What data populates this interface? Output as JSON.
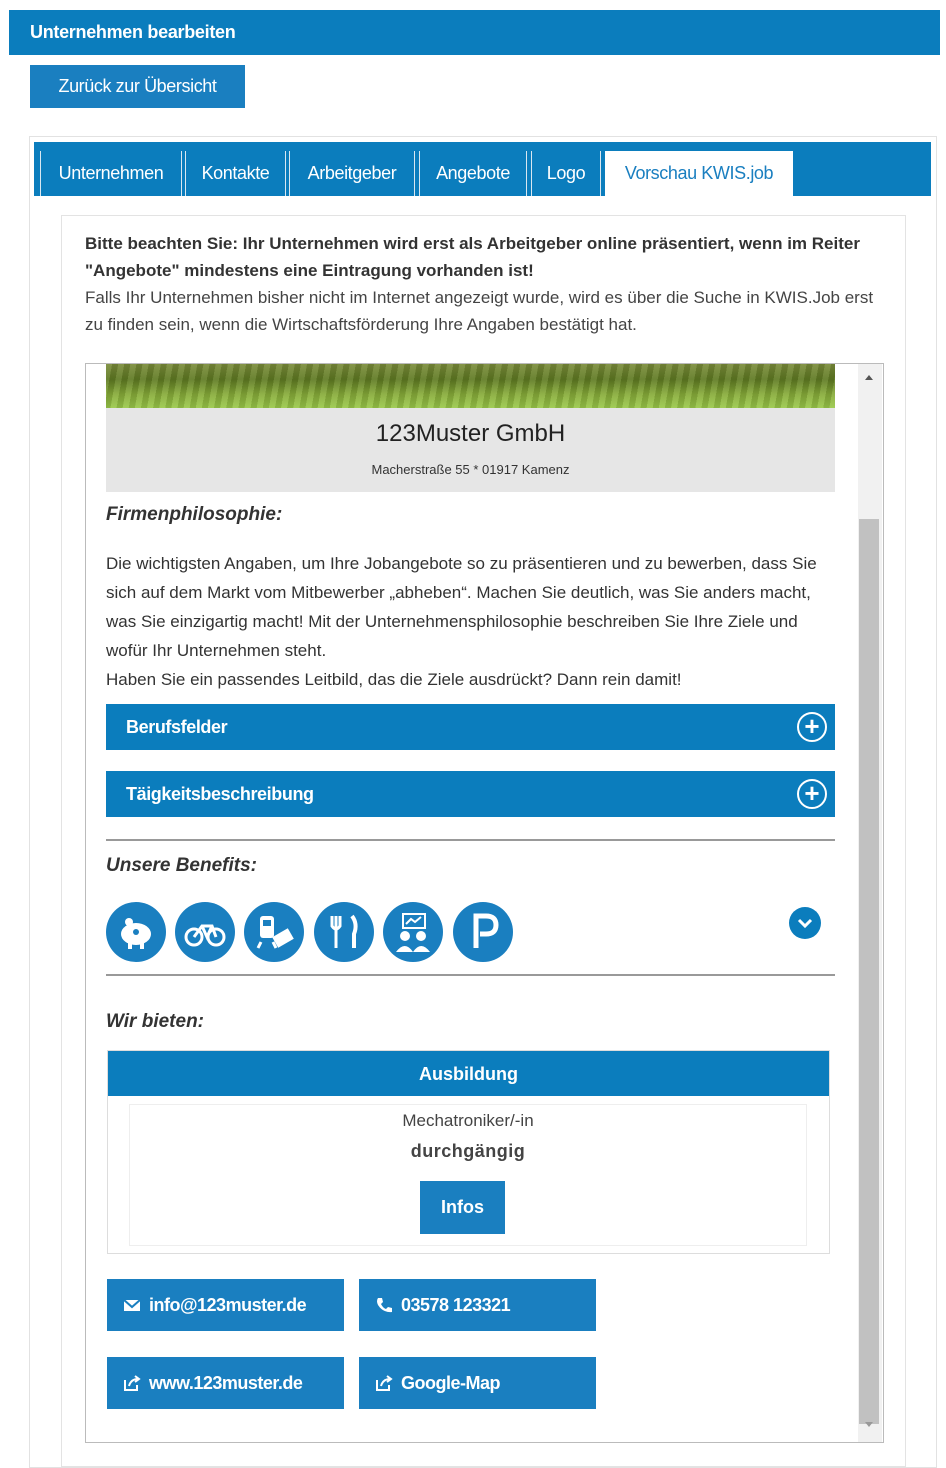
{
  "header": {
    "title": "Unternehmen bearbeiten"
  },
  "back_button": {
    "label": "Zurück zur Übersicht"
  },
  "tabs": [
    {
      "label": "Unternehmen"
    },
    {
      "label": "Kontakte"
    },
    {
      "label": "Arbeitgeber"
    },
    {
      "label": "Angebote"
    },
    {
      "label": "Logo"
    },
    {
      "label": "Vorschau KWIS.job",
      "active": true
    }
  ],
  "notice": {
    "bold": "Bitte beachten Sie: Ihr Unternehmen wird erst als Arbeitgeber online präsentiert, wenn im Reiter \"Angebote\" mindestens eine Eintragung vorhanden ist!",
    "text": "Falls Ihr Unternehmen bisher nicht im Internet angezeigt wurde, wird es über die Suche in KWIS.Job erst zu finden sein, wenn die Wirtschaftsförderung Ihre Angaben bestätigt hat."
  },
  "preview": {
    "company_name": "123Muster GmbH",
    "address": "Macherstraße 55 * 01917 Kamenz",
    "philosophy_title": "Firmenphilosophie:",
    "philosophy_text": "Die wichtigsten Angaben, um Ihre Jobangebote so zu präsentieren und zu bewerben, dass Sie sich auf dem Markt vom Mitbewerber „abheben“. Machen Sie deutlich, was Sie anders macht, was Sie einzigartig macht! Mit der Unternehmensphilosophie beschreiben Sie Ihre Ziele und wofür Ihr Unternehmen steht.",
    "philosophy_text2": "Haben Sie ein passendes Leitbild, das die Ziele ausdrückt? Dann rein damit!",
    "accordions": [
      {
        "label": "Berufsfelder"
      },
      {
        "label": "Täigkeitsbeschreibung"
      }
    ],
    "benefits_title": "Unsere Benefits:",
    "benefits": [
      {
        "icon": "piggy-bank-icon"
      },
      {
        "icon": "bicycle-icon"
      },
      {
        "icon": "public-transport-ticket-icon"
      },
      {
        "icon": "canteen-fork-knife-icon"
      },
      {
        "icon": "training-presentation-icon"
      },
      {
        "icon": "parking-icon"
      }
    ],
    "offers_title": "Wir bieten:",
    "offer": {
      "category": "Ausbildung",
      "job": "Mechatroniker/-in",
      "duration": "durchgängig",
      "button": "Infos"
    },
    "contacts": {
      "email": "info@123muster.de",
      "phone": "03578 123321",
      "website": "www.123muster.de",
      "map": "Google-Map"
    }
  },
  "colors": {
    "primary": "#0b7dbd",
    "button": "#1a7fc0",
    "company_bg": "#e6e6e6"
  }
}
